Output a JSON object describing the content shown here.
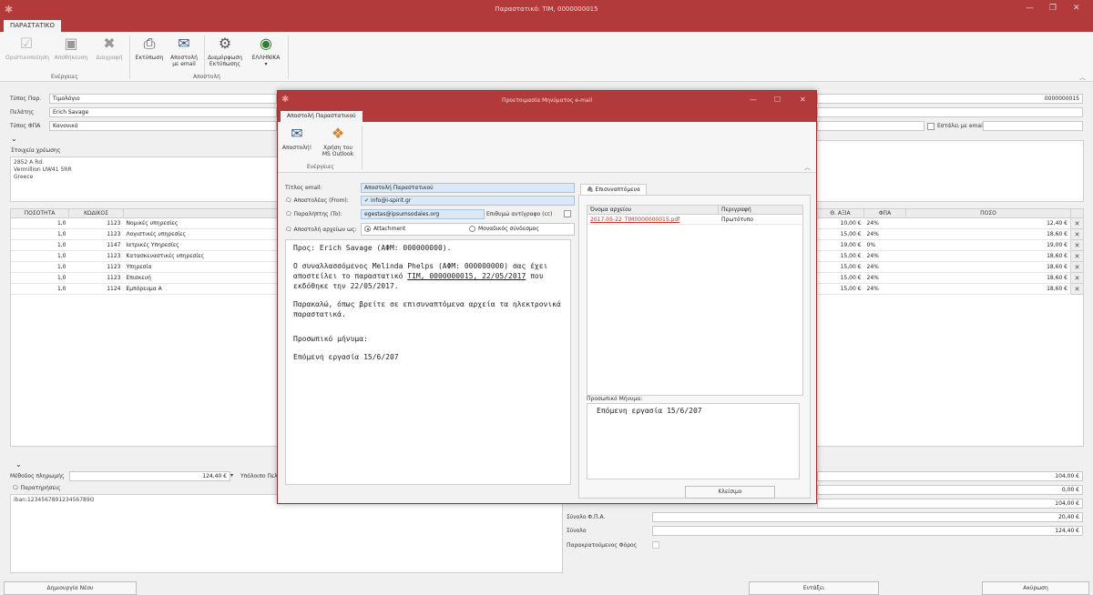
{
  "window": {
    "title": "Παραστατικό: ΤΙΜ, 0000000015",
    "ribbon_tab": "ΠΑΡΑΣΤΑΤΙΚΟ"
  },
  "ribbon": {
    "finalize": "Οριστικοποίηση",
    "save": "Αποθήκευση",
    "delete": "Διαγραφή",
    "print": "Εκτύπωση",
    "send_email": "Αποστολή με email",
    "print_layout": "Διαμόρφωση Εκτύπωσης",
    "language": "ΕΛΛΗΝΙΚΑ",
    "group_actions": "Ενέργειες",
    "group_send": "Αποστολή"
  },
  "form": {
    "doc_type_label": "Τύπος Παρ.",
    "doc_type_value": "Τιμολόγιο",
    "doc_number": "0000000015",
    "customer_label": "Πελάτης",
    "customer_value": "Erich Savage",
    "vat_type_label": "Τύπος ΦΠΑ",
    "vat_type_value": "Κανονικό",
    "email_sent_label": "Εστάλει με email",
    "billing_label": "Στοιχεία χρέωσης",
    "billing_lines": [
      "2852 A Rd.",
      "Vermillion UW41 5RR",
      "Greece"
    ]
  },
  "grid": {
    "headers": [
      "ΠΟΣΟΤΗΤΑ",
      "ΚΩΔΙΚΟΣ",
      "Θ. ΑΞΙΑ",
      "ΦΠΑ",
      "ΠΟΣΟ"
    ],
    "rows": [
      {
        "qty": "1,0",
        "code": "1123",
        "desc": "Νομικές υπηρεσίες",
        "value": "10,00 €",
        "vat": "24%",
        "amount": "12,40 €"
      },
      {
        "qty": "1,0",
        "code": "1123",
        "desc": "Λογιστικές υπηρεσίες",
        "value": "15,00 €",
        "vat": "24%",
        "amount": "18,60 €"
      },
      {
        "qty": "1,0",
        "code": "1147",
        "desc": "Ιατρικές Υπηρεσίες",
        "value": "19,00 €",
        "vat": "0%",
        "amount": "19,00 €"
      },
      {
        "qty": "1,0",
        "code": "1123",
        "desc": "Κατασκευαστικές υπηρεσίες",
        "value": "15,00 €",
        "vat": "24%",
        "amount": "18,60 €"
      },
      {
        "qty": "1,0",
        "code": "1123",
        "desc": "Υπηρεσία",
        "value": "15,00 €",
        "vat": "24%",
        "amount": "18,60 €"
      },
      {
        "qty": "1,0",
        "code": "1123",
        "desc": "Επισκευή",
        "value": "15,00 €",
        "vat": "24%",
        "amount": "18,60 €"
      },
      {
        "qty": "1,0",
        "code": "1124",
        "desc": "Εμπόρευμα Α",
        "value": "15,00 €",
        "vat": "24%",
        "amount": "18,60 €"
      }
    ]
  },
  "bottom": {
    "payment_label": "Μέθοδος πληρωμής",
    "payment_value": "124,40 €",
    "balance_label": "Υπόλοιπο Πελ",
    "notes_label": "Παρατηρήσεις",
    "notes_value": "iban:123456789123456789O",
    "totals": [
      {
        "label": "",
        "value": "104,00 €"
      },
      {
        "label": "",
        "value": "0,00 €"
      },
      {
        "label": "",
        "value": "104,00 €"
      },
      {
        "label": "Σύνολο Φ.Π.Α.",
        "value": "20,40 €"
      },
      {
        "label": "Σύνολο",
        "value": "124,40 €"
      }
    ],
    "withholding_label": "Παρακρατούμενος Φόρος",
    "new_button": "Δημιουργία Νέου",
    "ok_button": "Εντάξει",
    "cancel_button": "Ακύρωση"
  },
  "modal": {
    "title": "Προετοιμασία Μηνύματος e-mail",
    "tab": "Αποστολή Παραστατικού",
    "send_button": "Αποστολή!",
    "outlook_button": "Χρήση του MS Outlook",
    "group_actions": "Ενέργειες",
    "subject_label": "Τίτλος email:",
    "subject_value": "Αποστολή Παραστατικού",
    "from_label": "Αποστολέας (From):",
    "from_value": "info@i-spirit.gr",
    "to_label": "Παραλήπτης (To):",
    "to_value": "egestas@ipsumsodales.org",
    "cc_label": "Επιθυμώ αντίγραφο (cc)",
    "attach_mode_label": "Αποστολή αρχείων ως:",
    "attach_option_1": "Attachment",
    "attach_option_2": "Μοναδικός σύνδεσμος",
    "body_greeting": "Προς: Erich Savage (ΑΦΜ: 000000000).",
    "body_p1_a": "Ο συναλλασσόμενος Melinda Phelps (ΑΦΜ: 000000000) σας έχει αποστείλει το παραστατικό ",
    "body_p1_link": "ΤΙΜ, 0000000015, 22/05/2017",
    "body_p1_b": " που εκδόθηκε την 22/05/2017.",
    "body_p2": "Παρακαλώ, όπως βρείτε σε επισυναπτόμενα αρχεία τα ηλεκτρονικά παραστατικά.",
    "body_p3": "Προσωπικό μήνυμα:",
    "body_p4": "Επόμενη εργασία 15/6/207",
    "attachments_tab": "Επισυναπτόμενα",
    "att_col_name": "Όνομα αρχείου",
    "att_col_desc": "Περιγραφή",
    "att_file": "2017-05-22_TIM0000000015.pdf",
    "att_file_desc": "Πρωτότυπο",
    "personal_msg_label": "Προσωπικό Μήνυμα:",
    "personal_msg_value": "Επόμενη εργασία 15/6/207",
    "close_button": "Κλείσιμο"
  },
  "colors": {
    "titlebar": "#b33a3a",
    "link": "#c0392b"
  }
}
